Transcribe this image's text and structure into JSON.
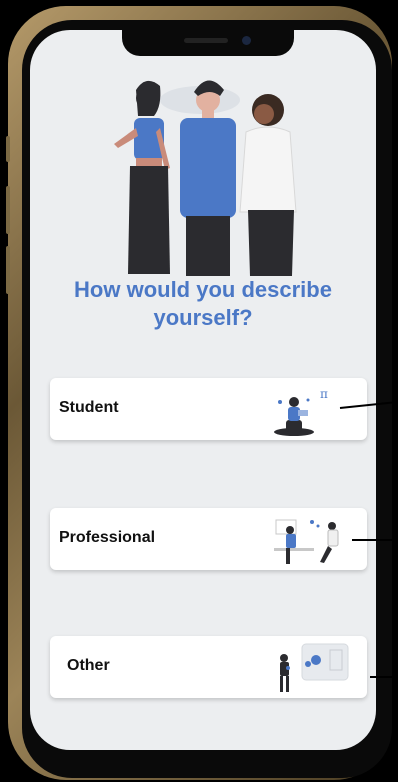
{
  "screen": {
    "title": "How would you describe yourself?"
  },
  "options": [
    {
      "label": "Student",
      "illustration": "student-reading-illustration"
    },
    {
      "label": "Professional",
      "illustration": "professionals-working-illustration"
    },
    {
      "label": "Other",
      "illustration": "person-with-board-illustration"
    }
  ],
  "colors": {
    "accent": "#4b78c6",
    "background": "#eceef0",
    "card": "#ffffff",
    "text": "#111111"
  }
}
